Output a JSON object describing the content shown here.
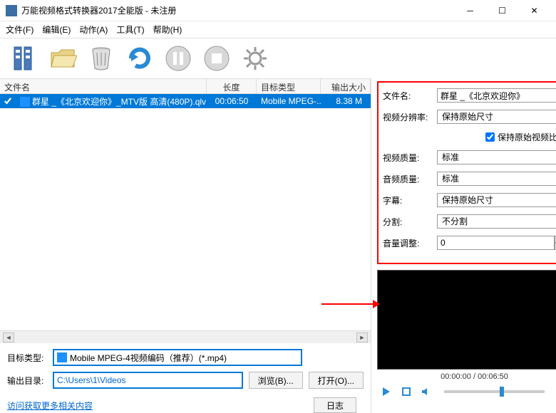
{
  "title": "万能视频格式转换器2017全能版 - 未注册",
  "menu": {
    "file": "文件(F)",
    "edit": "编辑(E)",
    "action": "动作(A)",
    "tool": "工具(T)",
    "help": "帮助(H)"
  },
  "columns": {
    "name": "文件名",
    "length": "长度",
    "format": "目标类型",
    "size": "输出大小"
  },
  "rows": [
    {
      "name": "群星 _《北京欢迎你》_MTV版 高清(480P).qlv",
      "length": "00:06:50",
      "format": "Mobile MPEG-...",
      "size": "8.38 M"
    }
  ],
  "bottom": {
    "target_label": "目标类型:",
    "target_value": "Mobile MPEG-4视频编码（推荐）(*.mp4)",
    "outdir_label": "输出目录:",
    "outdir_value": "C:\\Users\\1\\Videos",
    "browse": "浏览(B)...",
    "open": "打开(O)...",
    "link": "访问获取更多相关内容",
    "log": "日志"
  },
  "props": {
    "filename_label": "文件名:",
    "filename_value": "群星 _《北京欢迎你》",
    "res_label": "视频分辨率:",
    "res_value": "保持原始尺寸",
    "keep_ratio": "保持原始视频比率",
    "vq_label": "视频质量:",
    "vq_value": "标准",
    "aq_label": "音频质量:",
    "aq_value": "标准",
    "sub_label": "字幕:",
    "sub_value": "保持原始尺寸",
    "split_label": "分割:",
    "split_value": "不分割",
    "vol_label": "音量调整:",
    "vol_value": "0"
  },
  "preview": {
    "time": "00:00:00 / 00:06:50"
  }
}
